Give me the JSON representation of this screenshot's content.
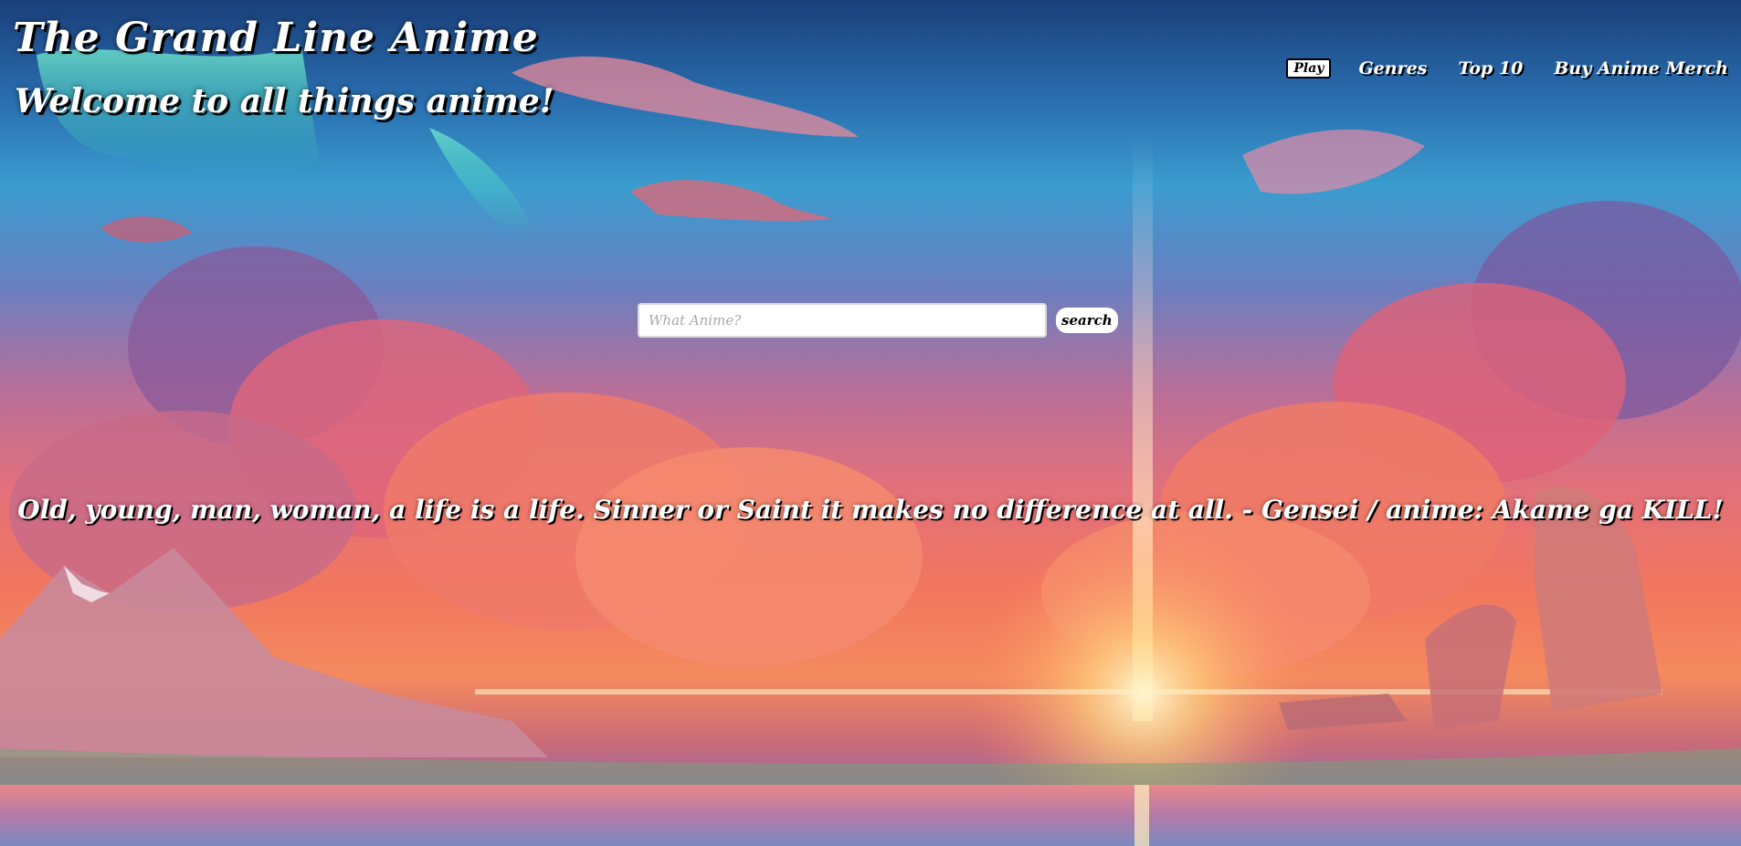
{
  "header": {
    "title": "The Grand Line Anime",
    "subtitle": "Welcome to all things anime!"
  },
  "nav": {
    "play_label": "Play",
    "links": [
      {
        "label": "Genres"
      },
      {
        "label": "Top 10"
      },
      {
        "label": "Buy Anime Merch"
      }
    ]
  },
  "search": {
    "placeholder": "What Anime?",
    "value": "",
    "button_label": "search"
  },
  "quote": {
    "text": "Old, young, man, woman, a life is a life. Sinner or Saint it makes no difference at all. - Gensei / anime: Akame ga KILL!"
  },
  "background": {
    "description_colors": {
      "sky_top": "#1a3f7a",
      "sky_mid": "#3a9ccf",
      "clouds": "#f2775e",
      "sun_glow": "#ffd27a"
    }
  }
}
